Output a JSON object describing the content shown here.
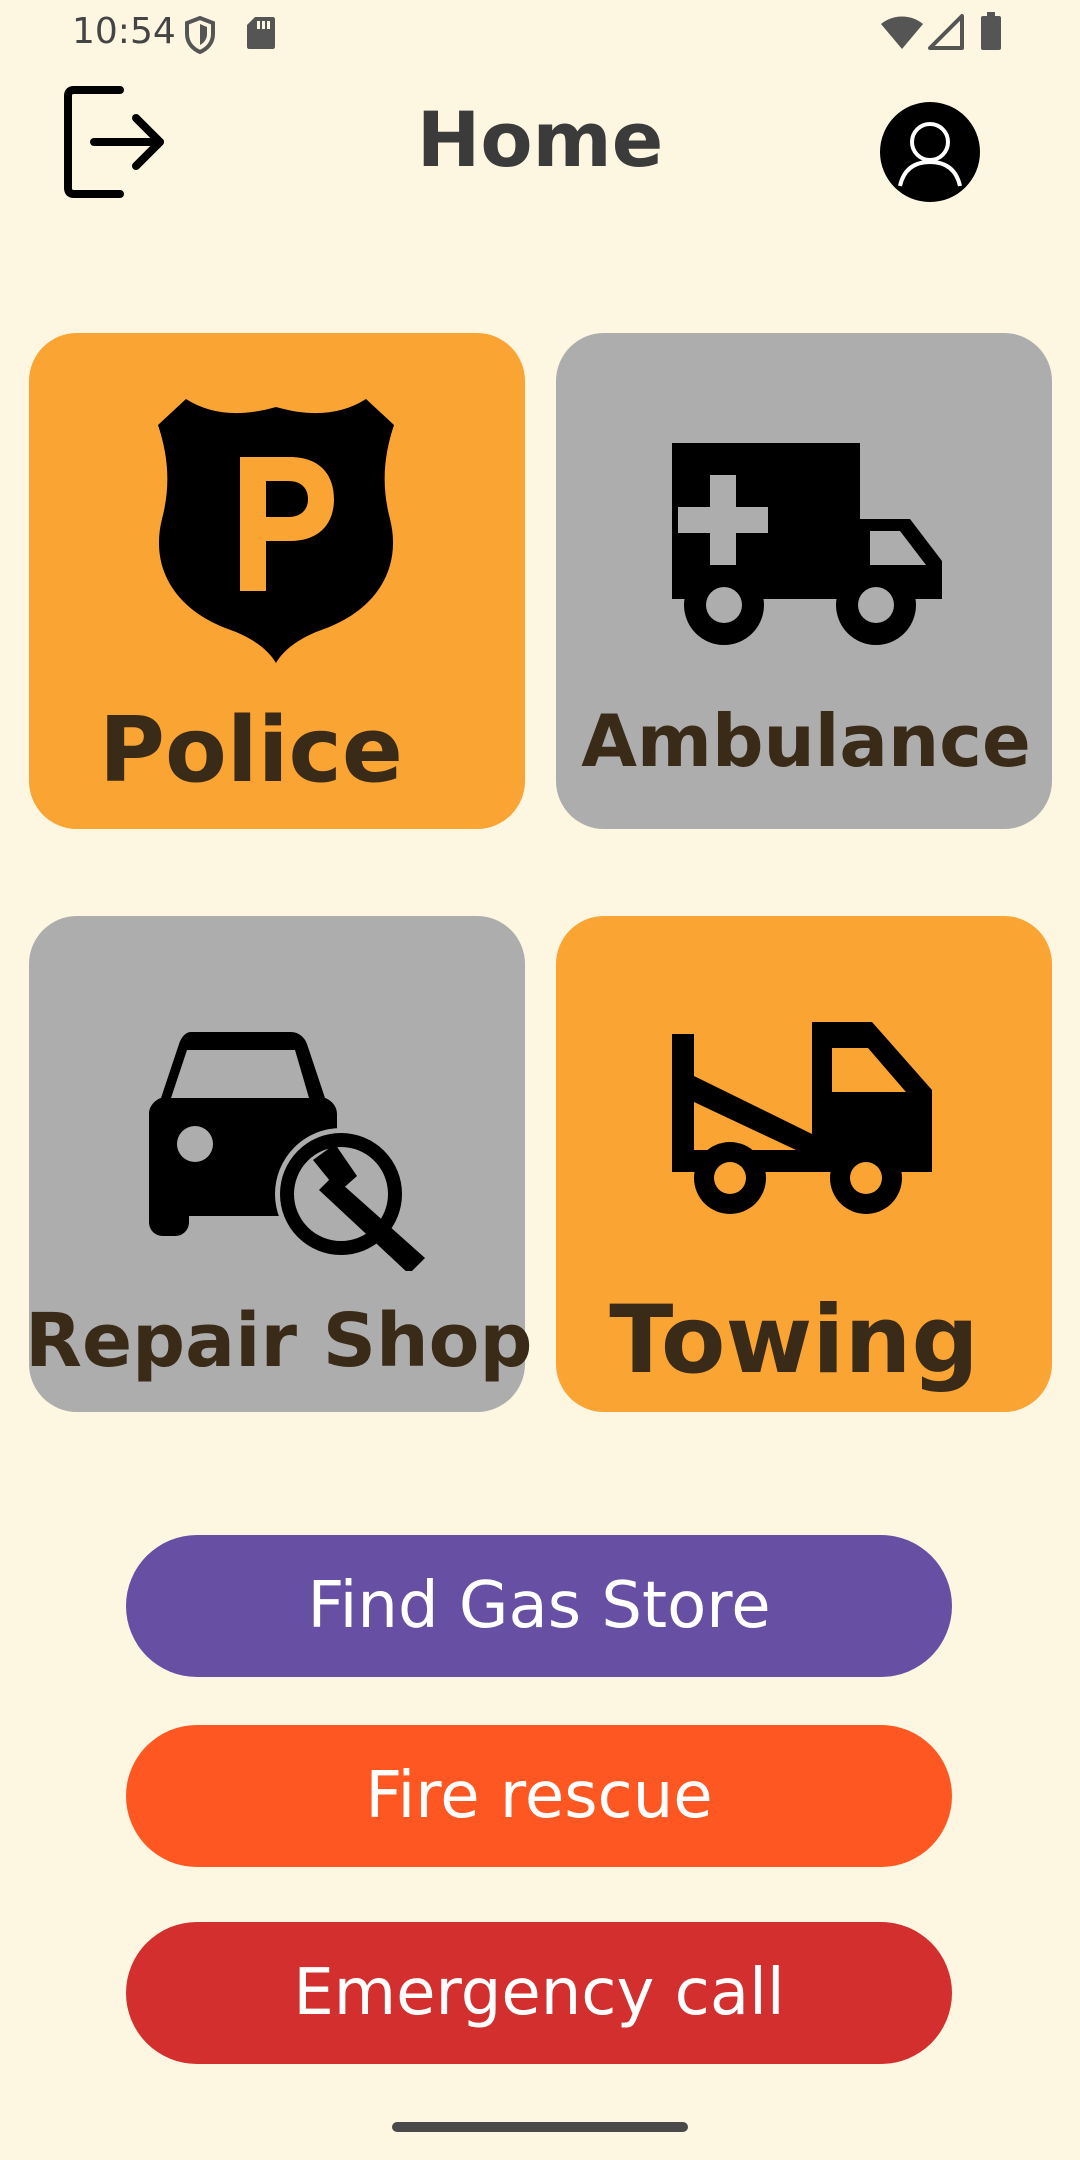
{
  "status_bar": {
    "time": "10:54"
  },
  "header": {
    "title": "Home"
  },
  "tiles": [
    {
      "label": "Police",
      "color": "#faa434",
      "icon": "police-badge-icon"
    },
    {
      "label": "Ambulance",
      "color": "#adadad",
      "icon": "ambulance-icon"
    },
    {
      "label": "Repair Shop",
      "color": "#adadad",
      "icon": "car-repair-icon"
    },
    {
      "label": "Towing",
      "color": "#faa434",
      "icon": "tow-truck-icon"
    }
  ],
  "actions": [
    {
      "label": "Find Gas Store",
      "color": "#6750a4"
    },
    {
      "label": "Fire rescue",
      "color": "#ff5722"
    },
    {
      "label": "Emergency call",
      "color": "#d32f2f"
    }
  ],
  "theme": {
    "background": "#fdf6e1",
    "tile_label_color": "#3a2a18"
  }
}
